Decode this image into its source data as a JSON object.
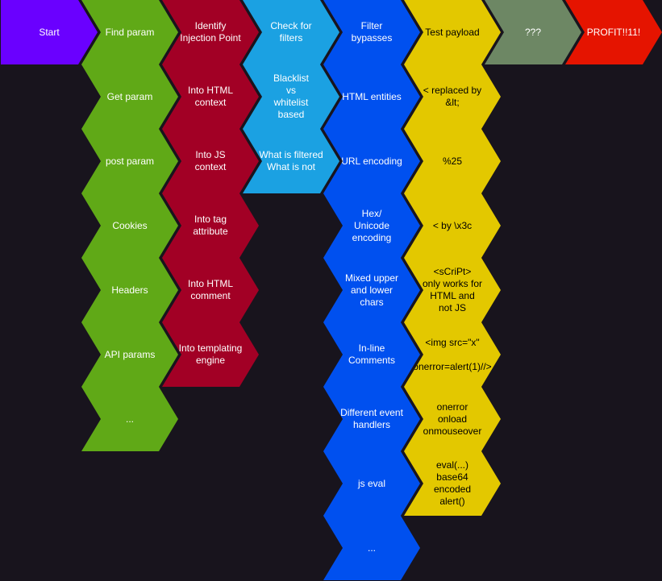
{
  "colors": {
    "background": "#18141d",
    "start": "#6a00ff",
    "find_param": "#60a917",
    "injection_point": "#a20025",
    "filters": "#1ba1e2",
    "bypasses": "#0050ef",
    "payload": "#e3c800",
    "unknown": "#6d8764",
    "profit": "#e51400"
  },
  "header": [
    {
      "name": "start-step",
      "label": "Start",
      "color": "#6a00ff",
      "text": "#ffffff"
    },
    {
      "name": "find-param-step",
      "label": "Find param",
      "color": "#60a917",
      "text": "#ffffff"
    },
    {
      "name": "identify-injection-point-step",
      "label": "Identify\nInjection Point",
      "color": "#a20025",
      "text": "#ffffff"
    },
    {
      "name": "check-for-filters-step",
      "label": "Check for\nfilters",
      "color": "#1ba1e2",
      "text": "#ffffff"
    },
    {
      "name": "filter-bypasses-step",
      "label": "Filter\nbypasses",
      "color": "#0050ef",
      "text": "#ffffff"
    },
    {
      "name": "test-payload-step",
      "label": "Test payload",
      "color": "#e3c800",
      "text": "#000000"
    },
    {
      "name": "unknown-step",
      "label": "???",
      "color": "#6d8764",
      "text": "#ffffff"
    },
    {
      "name": "profit-step",
      "label": "PROFIT!!11!",
      "color": "#e51400",
      "text": "#ffffff"
    }
  ],
  "columns": [
    {
      "name": "find-param-column",
      "color": "#60a917",
      "text": "#ffffff",
      "items": [
        "Get param",
        "post param",
        "Cookies",
        "Headers",
        "API params",
        "..."
      ]
    },
    {
      "name": "injection-point-column",
      "color": "#a20025",
      "text": "#ffffff",
      "items": [
        "Into HTML\ncontext",
        "Into JS\ncontext",
        "Into tag\nattribute",
        "Into HTML\ncomment",
        "Into templating\nengine"
      ]
    },
    {
      "name": "filters-column",
      "color": "#1ba1e2",
      "text": "#ffffff",
      "items": [
        "Blacklist\nvs\nwhitelist\nbased",
        "What is filtered\nWhat is not"
      ]
    },
    {
      "name": "bypasses-column",
      "color": "#0050ef",
      "text": "#ffffff",
      "items": [
        "HTML entities",
        "URL encoding",
        "Hex/\nUnicode\nencoding",
        "Mixed upper\nand lower\nchars",
        "In-line\nComments",
        "Different event\nhandlers",
        "js eval",
        "..."
      ]
    },
    {
      "name": "payload-column",
      "color": "#e3c800",
      "text": "#000000",
      "items": [
        "< replaced by\n&lt;",
        "%25",
        "< by \\x3c",
        "<sCriPt>\nonly works for\nHTML and\nnot JS",
        "<img src=\"x\"\n\nonerror=alert(1)//>",
        "onerror\nonload\nonmouseover",
        "eval(...)\nbase64\nencoded\nalert()"
      ]
    }
  ]
}
